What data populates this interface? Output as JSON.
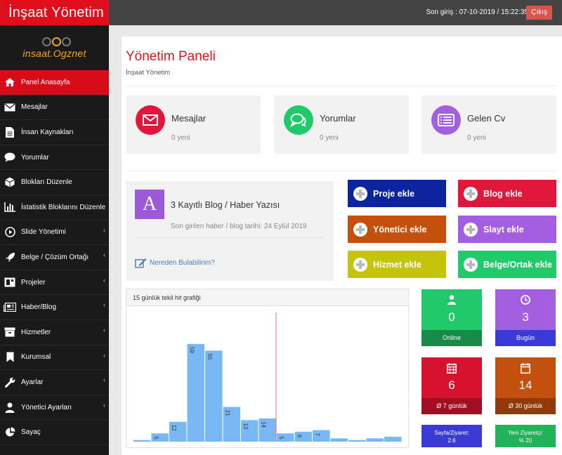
{
  "header": {
    "brand": "İnşaat Yönetim",
    "last_login": "Son giriş : 07-10-2019 / 15:22:35",
    "logout_label": "Çıkış"
  },
  "logo": {
    "text": "insaat.Ogznet"
  },
  "sidebar": {
    "items": [
      {
        "label": "Panel Anasayfa",
        "icon": "home-icon",
        "active": true
      },
      {
        "label": "Mesajlar",
        "icon": "envelope-icon"
      },
      {
        "label": "İnsan Kaynakları",
        "icon": "file-icon"
      },
      {
        "label": "Yorumlar",
        "icon": "comment-icon"
      },
      {
        "label": "Blokları Düzenle",
        "icon": "cube-icon"
      },
      {
        "label": "İstatistik Bloklarını Düzenle",
        "icon": "bar-chart-icon"
      },
      {
        "label": "Slide Yönetimi",
        "icon": "play-icon",
        "caret": "‹"
      },
      {
        "label": "Belge / Çözüm Ortağı",
        "icon": "rocket-icon",
        "caret": "‹"
      },
      {
        "label": "Projeler",
        "icon": "image-icon",
        "caret": "‹"
      },
      {
        "label": "Haber/Blog",
        "icon": "newspaper-icon",
        "caret": "‹"
      },
      {
        "label": "Hizmetler",
        "icon": "archive-icon",
        "caret": "‹"
      },
      {
        "label": "Kurumsal",
        "icon": "bookmark-icon",
        "caret": "‹"
      },
      {
        "label": "Ayarlar",
        "icon": "wrench-icon",
        "caret": "‹"
      },
      {
        "label": "Yönetici Ayarları",
        "icon": "user-icon",
        "caret": "‹"
      },
      {
        "label": "Sayaç",
        "icon": "pie-chart-icon"
      }
    ]
  },
  "page": {
    "title": "Yönetim Paneli",
    "subtitle": "İnşaat Yönetim"
  },
  "stats": [
    {
      "title": "Mesajlar",
      "count": "0 yeni",
      "color": "#e0163a",
      "icon": "envelope-icon"
    },
    {
      "title": "Yorumlar",
      "count": "0 yeni",
      "color": "#21c96a",
      "icon": "comments-icon"
    },
    {
      "title": "Gelen Cv",
      "count": "0 yeni",
      "color": "#a45ee0",
      "icon": "cv-list-icon"
    }
  ],
  "blog": {
    "letter": "A",
    "title": "3 Kayıtlı Blog / Haber Yazısı",
    "last_date": "Son girilen haber / blog tarihi: 24 Eylül 2019",
    "link": "Nereden Bulabilirim?"
  },
  "actions": [
    {
      "label": "Proje ekle",
      "color": "#0a24a0"
    },
    {
      "label": "Blog ekle",
      "color": "#e0163a"
    },
    {
      "label": "Yönetici ekle",
      "color": "#c4500e"
    },
    {
      "label": "Slayt ekle",
      "color": "#a45ee0"
    },
    {
      "label": "Hizmet ekle",
      "color": "#c4c40a"
    },
    {
      "label": "Belge/Ortak ekle",
      "color": "#21c96a"
    }
  ],
  "chart_title": "15 günlük tekil hit grafiği",
  "chart_data": {
    "type": "bar",
    "title": "15 günlük tekil hit grafiği",
    "values": [
      1,
      5,
      12,
      59,
      55,
      21,
      13,
      14,
      5,
      6,
      7,
      2,
      1,
      2,
      3
    ],
    "data_labels": [
      null,
      "5",
      "12",
      "59",
      "55",
      "21",
      "13",
      "14",
      "5",
      "6",
      "7",
      null,
      null,
      null,
      null
    ],
    "ylim": [
      0,
      70
    ],
    "marker_after_index": 7,
    "bar_color": "#7ab8f5",
    "marker_color": "#e07070"
  },
  "tiles": [
    {
      "value": "0",
      "label": "Online",
      "color": "#21c96a",
      "foot_color": "#178a48",
      "icon": "user-icon"
    },
    {
      "value": "3",
      "label": "Bugün",
      "color": "#a45ee0",
      "foot_color": "#3a3ad6",
      "icon": "clock-icon"
    },
    {
      "value": "6",
      "label": "Ø 7 günlük",
      "color": "#d6122e",
      "foot_color": "#a00e22",
      "icon": "calendar-grid-icon"
    },
    {
      "value": "14",
      "label": "Ø 30 günlük",
      "color": "#c4500e",
      "foot_color": "#8f3a08",
      "icon": "calendar-icon"
    }
  ],
  "mini_tiles": [
    {
      "line1": "Sayfa/Ziyaret:",
      "line2": "2.6",
      "color": "#3a3ad6"
    },
    {
      "line1": "Yeni Ziyaretçi:",
      "line2": "% 20",
      "color": "#21b25a"
    }
  ]
}
